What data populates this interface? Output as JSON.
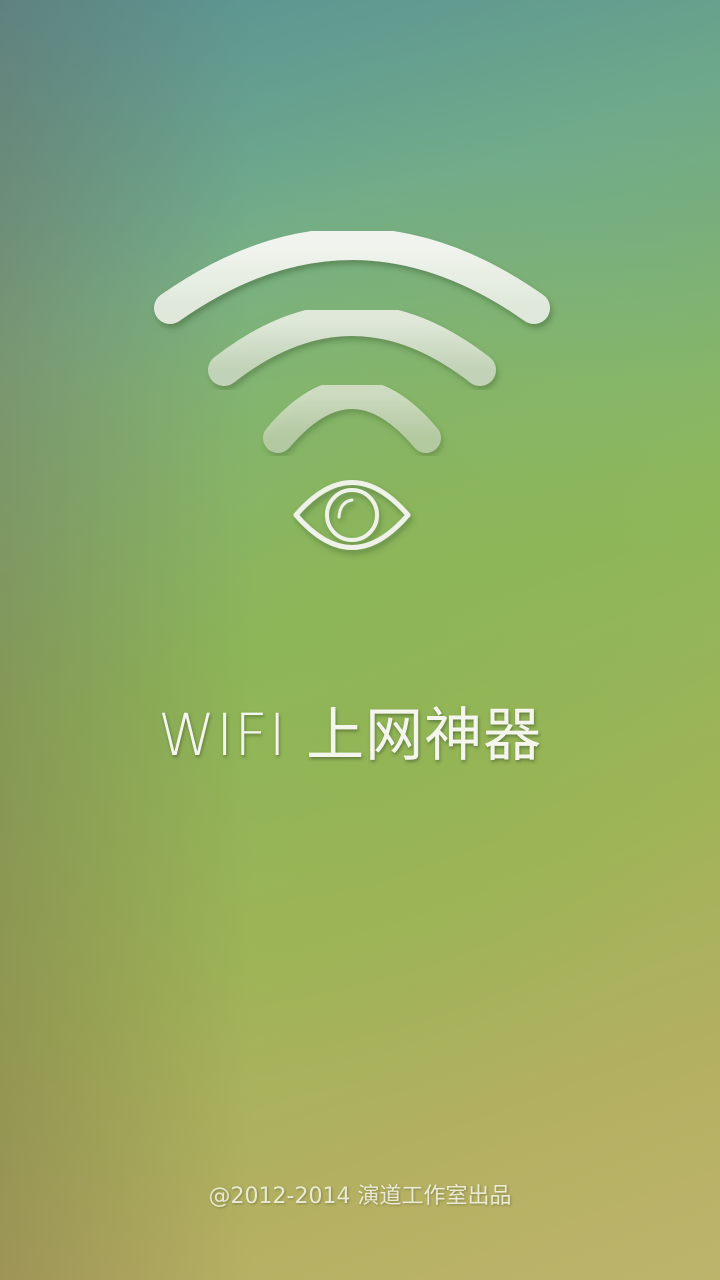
{
  "splash": {
    "app_title": "WIFI 上网神器",
    "copyright": "@2012-2014 演道工作室出品",
    "logo": {
      "wifi_icon": "wifi-signal-icon",
      "eye_icon": "eye-icon"
    }
  },
  "colors": {
    "background_top_left": "#5f9a97",
    "background_center": "#8cb75b",
    "background_bottom_right": "#bdb46c",
    "icon_fill": "#eef2e8",
    "text": "#f4f6ee"
  }
}
